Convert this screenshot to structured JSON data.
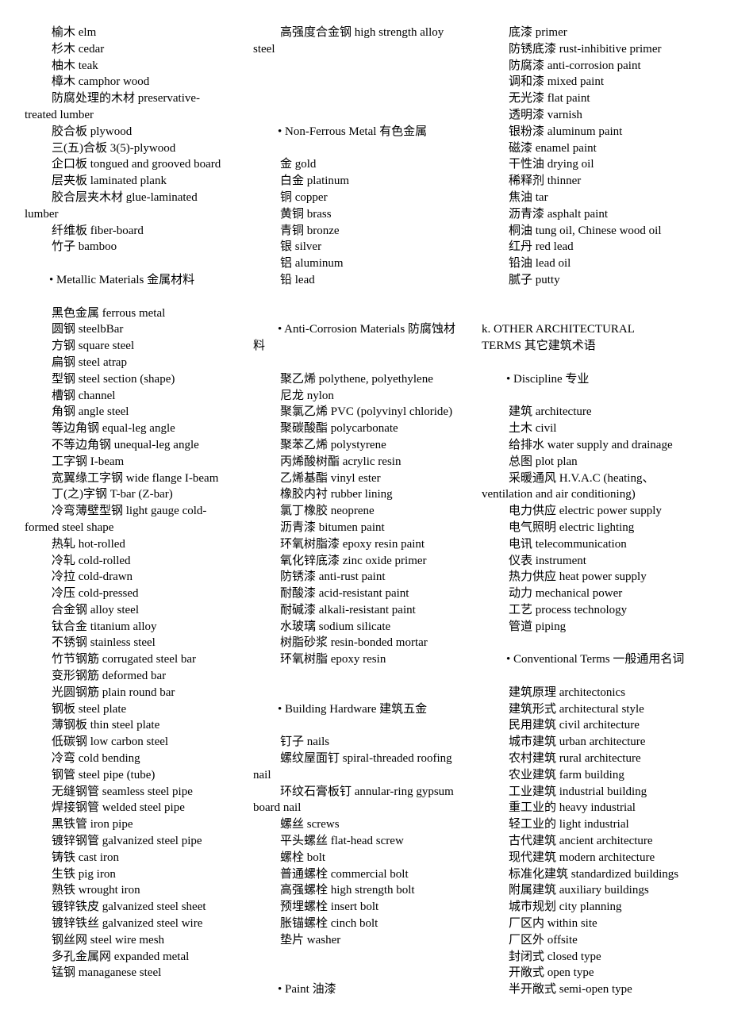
{
  "columns": [
    {
      "entries": [
        [
          "榆木 elm"
        ],
        [
          "杉木 cedar"
        ],
        [
          "柚木 teak"
        ],
        [
          "樟木 camphor wood"
        ],
        [
          "防腐处理的木材 preservative-",
          "treated lumber"
        ],
        [
          "胶合板 plywood"
        ],
        [
          "三(五)合板 3(5)-plywood"
        ],
        [
          "企口板 tongued and grooved board"
        ],
        [
          "层夹板 laminated plank"
        ],
        [
          "胶合层夹木材 glue-laminated",
          "lumber"
        ],
        [
          "纤维板 fiber-board"
        ],
        [
          "竹子 bamboo"
        ],
        [],
        [
          "• Metallic Materials 金属材料"
        ],
        [],
        [
          "黑色金属 ferrous metal"
        ],
        [
          "圆钢 steelbBar"
        ],
        [
          "方钢 square steel"
        ],
        [
          "扁钢 steel atrap"
        ],
        [
          "型钢 steel section (shape)"
        ],
        [
          "槽钢 channel"
        ],
        [
          "角钢 angle steel"
        ],
        [
          "等边角钢 equal-leg angle"
        ],
        [
          "不等边角钢 unequal-leg angle"
        ],
        [
          "工字钢 I-beam"
        ],
        [
          "宽翼缘工字钢 wide flange I-beam"
        ],
        [
          "丁(之)字钢 T-bar (Z-bar)"
        ],
        [
          "冷弯薄壁型钢 light gauge cold-",
          "formed steel shape"
        ],
        [
          "热轧 hot-rolled"
        ],
        [
          "冷轧 cold-rolled"
        ],
        [
          "冷拉 cold-drawn"
        ],
        [
          "冷压 cold-pressed"
        ],
        [
          "合金钢 alloy steel"
        ],
        [
          "钛合金 titanium alloy"
        ],
        [
          "不锈钢 stainless steel"
        ],
        [
          "竹节钢筋 corrugated steel bar"
        ],
        [
          "变形钢筋 deformed bar"
        ],
        [
          "光圆钢筋 plain round bar"
        ],
        [
          "钢板 steel plate"
        ],
        [
          "薄钢板 thin steel plate"
        ],
        [
          "低碳钢 low carbon steel"
        ],
        [
          "冷弯 cold bending"
        ],
        [
          "钢管 steel pipe (tube)"
        ],
        [
          "无缝钢管 seamless steel pipe"
        ],
        [
          "焊接钢管 welded steel pipe"
        ],
        [
          "黑铁管 iron pipe"
        ],
        [
          "镀锌钢管 galvanized steel pipe"
        ],
        [
          "铸铁 cast iron"
        ],
        [
          "生铁 pig iron"
        ],
        [
          "熟铁 wrought iron"
        ],
        [
          "镀锌铁皮 galvanized steel sheet"
        ],
        [
          "镀锌铁丝 galvanized steel wire"
        ],
        [
          "钢丝网 steel wire mesh"
        ],
        [
          "多孔金属网 expanded metal"
        ],
        [
          "锰钢 managanese steel"
        ]
      ]
    },
    {
      "entries": [
        [
          "高强度合金钢 high strength alloy",
          "steel"
        ],
        [],
        [],
        [],
        [],
        [
          "• Non-Ferrous Metal 有色金属"
        ],
        [],
        [
          "金 gold"
        ],
        [
          "白金 platinum"
        ],
        [
          "铜 copper"
        ],
        [
          "黄铜 brass"
        ],
        [
          "青铜 bronze"
        ],
        [
          "银 silver"
        ],
        [
          "铝 aluminum"
        ],
        [
          "铅 lead"
        ],
        [],
        [],
        [
          "• Anti-Corrosion Materials 防腐蚀材",
          "料"
        ],
        [],
        [
          "聚乙烯 polythene, polyethylene"
        ],
        [
          "尼龙 nylon"
        ],
        [
          "聚氯乙烯 PVC (polyvinyl chloride)"
        ],
        [
          "聚碳酸酯 polycarbonate"
        ],
        [
          "聚苯乙烯 polystyrene"
        ],
        [
          "丙烯酸树酯 acrylic resin"
        ],
        [
          "乙烯基酯 vinyl ester"
        ],
        [
          "橡胶内衬 rubber lining"
        ],
        [
          "氯丁橡胶 neoprene"
        ],
        [
          "沥青漆 bitumen paint"
        ],
        [
          "环氧树脂漆 epoxy resin paint"
        ],
        [
          "氧化锌底漆 zinc oxide primer"
        ],
        [
          "防锈漆 anti-rust paint"
        ],
        [
          "耐酸漆 acid-resistant paint"
        ],
        [
          "耐碱漆 alkali-resistant paint"
        ],
        [
          "水玻璃 sodium silicate"
        ],
        [
          "树脂砂浆 resin-bonded mortar"
        ],
        [
          "环氧树脂 epoxy resin"
        ],
        [],
        [],
        [
          "• Building Hardware 建筑五金"
        ],
        [],
        [
          "钉子 nails"
        ],
        [
          "螺纹屋面钉 spiral-threaded roofing",
          "nail"
        ],
        [
          "环纹石膏板钉 annular-ring gypsum",
          "board nail"
        ],
        [
          "螺丝 screws"
        ],
        [
          "平头螺丝 flat-head screw"
        ],
        [
          "螺栓 bolt"
        ],
        [
          "普通螺栓 commercial bolt"
        ],
        [
          "高强螺栓 high strength bolt"
        ],
        [
          "预埋螺栓 insert bolt"
        ],
        [
          "胀锚螺栓 cinch bolt"
        ],
        [
          "垫片 washer"
        ],
        [],
        [],
        [
          "• Paint 油漆"
        ]
      ]
    },
    {
      "entries": [
        [
          "底漆 primer"
        ],
        [
          "防锈底漆 rust-inhibitive primer"
        ],
        [
          "防腐漆 anti-corrosion paint"
        ],
        [
          "调和漆 mixed paint"
        ],
        [
          "无光漆 flat paint"
        ],
        [
          "透明漆 varnish"
        ],
        [
          "银粉漆 aluminum paint"
        ],
        [
          "磁漆 enamel paint"
        ],
        [
          "干性油 drying oil"
        ],
        [
          "稀释剂 thinner"
        ],
        [
          "焦油 tar"
        ],
        [
          "沥青漆 asphalt paint"
        ],
        [
          "桐油 tung oil, Chinese wood oil"
        ],
        [
          "红丹 red lead"
        ],
        [
          "铅油 lead oil"
        ],
        [
          "腻子 putty"
        ],
        [],
        [],
        [
          "k. OTHER ARCHITECTURAL",
          "TERMS 其它建筑术语"
        ],
        [],
        [
          "• Discipline 专业"
        ],
        [],
        [
          "建筑 architecture"
        ],
        [
          "土木 civil"
        ],
        [
          "给排水 water supply and drainage"
        ],
        [
          "总图 plot plan"
        ],
        [
          "采暖通风 H.V.A.C (heating、",
          "ventilation and air conditioning)"
        ],
        [
          "电力供应 electric power supply"
        ],
        [
          "电气照明 electric lighting"
        ],
        [
          "电讯 telecommunication"
        ],
        [
          "仪表 instrument"
        ],
        [
          "热力供应 heat power supply"
        ],
        [
          "动力 mechanical power"
        ],
        [
          "工艺 process technology"
        ],
        [
          "管道 piping"
        ],
        [],
        [
          "• Conventional Terms 一般通用名词"
        ],
        [],
        [
          "建筑原理 architectonics"
        ],
        [
          "建筑形式 architectural style"
        ],
        [
          "民用建筑 civil architecture"
        ],
        [
          "城市建筑 urban architecture"
        ],
        [
          "农村建筑 rural architecture"
        ],
        [
          "农业建筑 farm building"
        ],
        [
          "工业建筑 industrial building"
        ],
        [
          "重工业的 heavy industrial"
        ],
        [
          "轻工业的 light industrial"
        ],
        [
          "古代建筑 ancient architecture"
        ],
        [
          "现代建筑 modern architecture"
        ],
        [
          "标准化建筑 standardized buildings"
        ],
        [
          "附属建筑 auxiliary buildings"
        ],
        [
          "城市规划 city planning"
        ],
        [
          "厂区内 within site"
        ],
        [
          "厂区外 offsite"
        ],
        [
          "封闭式 closed type"
        ],
        [
          "开敞式 open type"
        ],
        [
          "半开敞式 semi-open type"
        ]
      ]
    }
  ]
}
